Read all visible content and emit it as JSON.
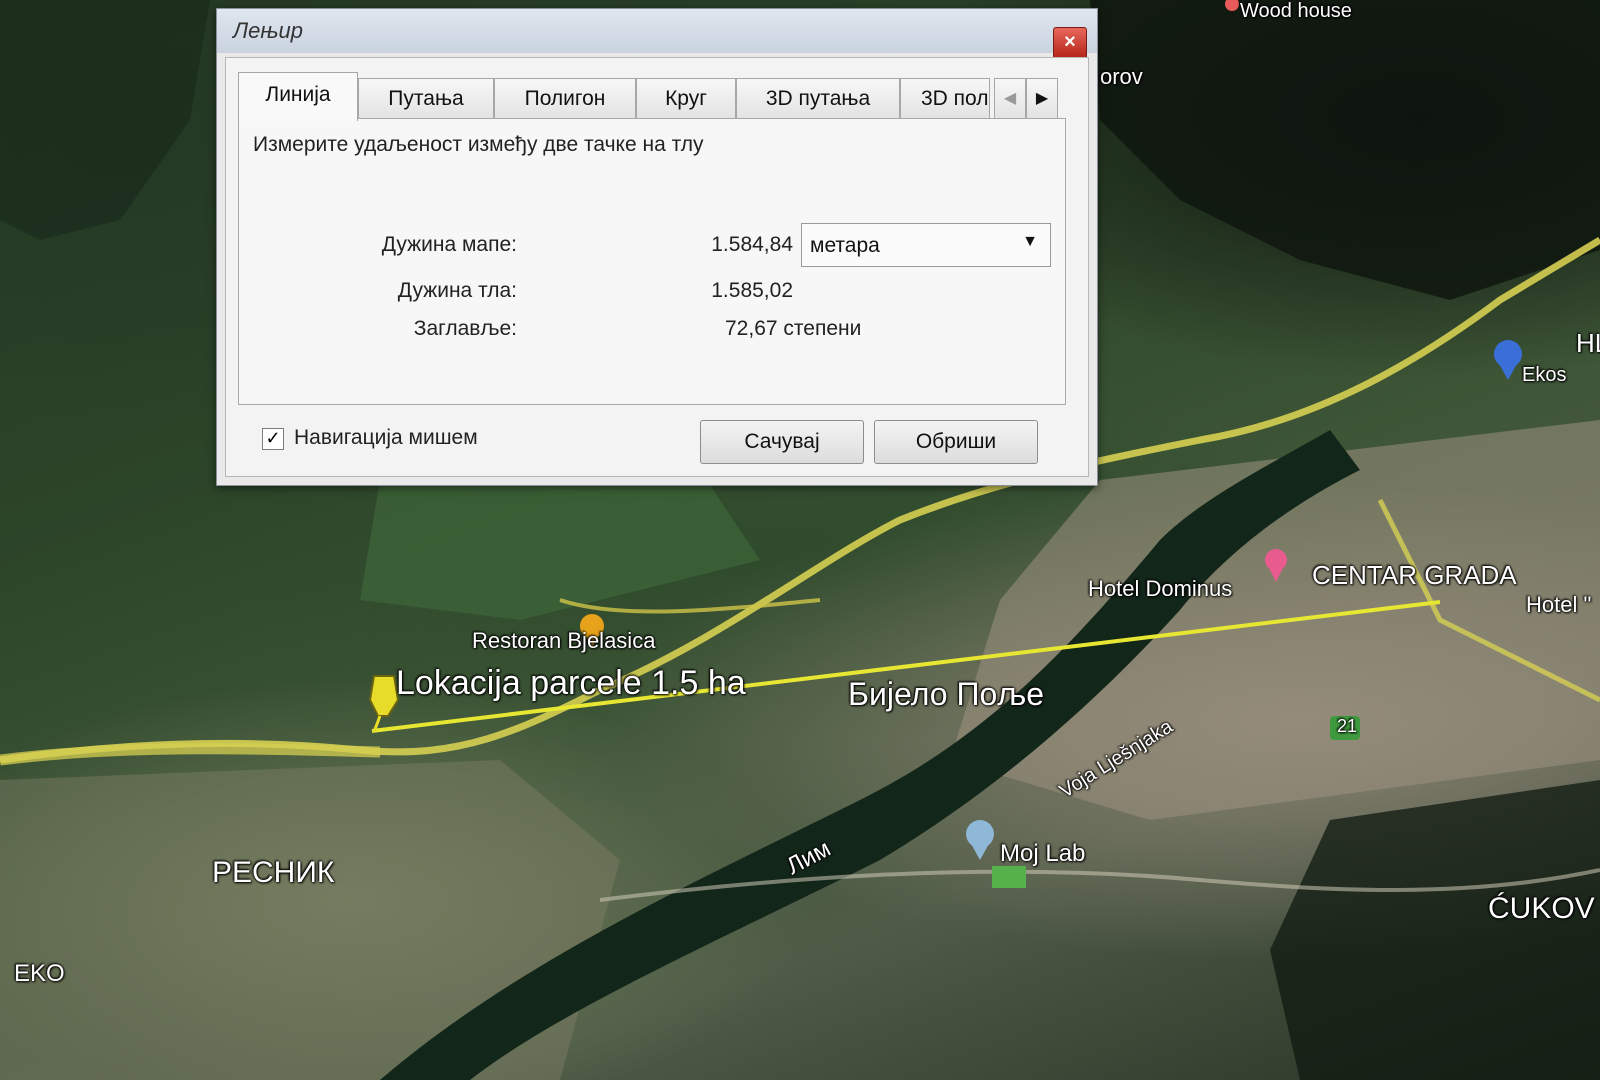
{
  "dialog": {
    "title": "Лењир",
    "close_label": "×",
    "tabs": [
      {
        "label": "Линија",
        "active": true
      },
      {
        "label": "Путања",
        "active": false
      },
      {
        "label": "Полигон",
        "active": false
      },
      {
        "label": "Круг",
        "active": false
      },
      {
        "label": "3D путања",
        "active": false
      },
      {
        "label": "3D пол",
        "active": false
      }
    ],
    "tab_scroll_left": "◀",
    "tab_scroll_right": "▶",
    "description": "Измерите удаљеност између две тачке на тлу",
    "map_length_label": "Дужина мапе:",
    "map_length_value": "1.584,84",
    "unit_selected": "метара",
    "ground_length_label": "Дужина тла:",
    "ground_length_value": "1.585,02",
    "heading_label": "Заглавље:",
    "heading_value": "72,67 степени",
    "mouse_nav_checked": true,
    "mouse_nav_check_glyph": "✓",
    "mouse_nav_label": "Навигација мишем",
    "save_label": "Сачувај",
    "clear_label": "Обриши"
  },
  "map": {
    "labels": {
      "wood_house": "Wood house",
      "orov": "orov",
      "hl": "HL",
      "ekos": "Ekos",
      "hotel_dominus": "Hotel Dominus",
      "centar_grada": "CENTAR GRADA",
      "hotel": "Hotel \"",
      "restoran": "Restoran Bjelasica",
      "lokacija": "Lokacija parcele 1.5 ha",
      "bijelo_polje": "Бијело Поље",
      "voja_lješnjaka": "Voja Lješnjaka",
      "route_21": "21",
      "lim": "Лим",
      "moj_lab": "Moj Lab",
      "resnik": "РЕСНИК",
      "eko": "EKO",
      "cukov": "ĆUKOV"
    },
    "colors": {
      "ruler_line": "#e6e633",
      "road": "#d6cf52",
      "river": "#13261a",
      "pin_yellow": "#e8dc2a",
      "pin_orange": "#e6a21a",
      "pin_pink": "#e85b8e",
      "pin_blue": "#3a6fd8"
    }
  }
}
